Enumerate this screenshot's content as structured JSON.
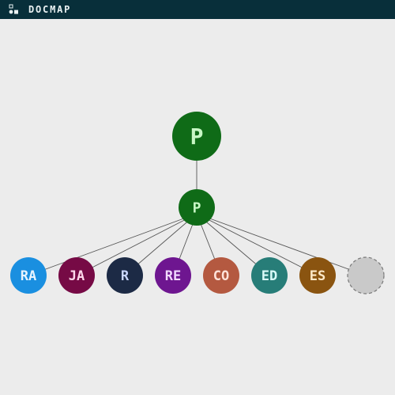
{
  "app": {
    "title": "DOCMAP",
    "logo_icon": "blocks-logo-icon"
  },
  "tree": {
    "root": {
      "label": "P",
      "color": "#0f6b17",
      "text_color": "#c8f7c5"
    },
    "child": {
      "label": "P",
      "color": "#0f6b17",
      "text_color": "#c8f7c5"
    },
    "leaves": [
      {
        "label": "RA",
        "color": "#1a8fe0",
        "text_color": "#e8f4ff"
      },
      {
        "label": "JA",
        "color": "#760a45",
        "text_color": "#ffd7ea"
      },
      {
        "label": "R",
        "color": "#1c2a45",
        "text_color": "#c9d6ff"
      },
      {
        "label": "RE",
        "color": "#6e1690",
        "text_color": "#f1d9ff"
      },
      {
        "label": "CO",
        "color": "#b45940",
        "text_color": "#ffe3da"
      },
      {
        "label": "ED",
        "color": "#277d78",
        "text_color": "#d9fbf8"
      },
      {
        "label": "ES",
        "color": "#8a5410",
        "text_color": "#ffe9c8"
      },
      {
        "label": "",
        "color": "#c9c9c9",
        "text_color": "#ffffff",
        "placeholder": true
      }
    ]
  }
}
